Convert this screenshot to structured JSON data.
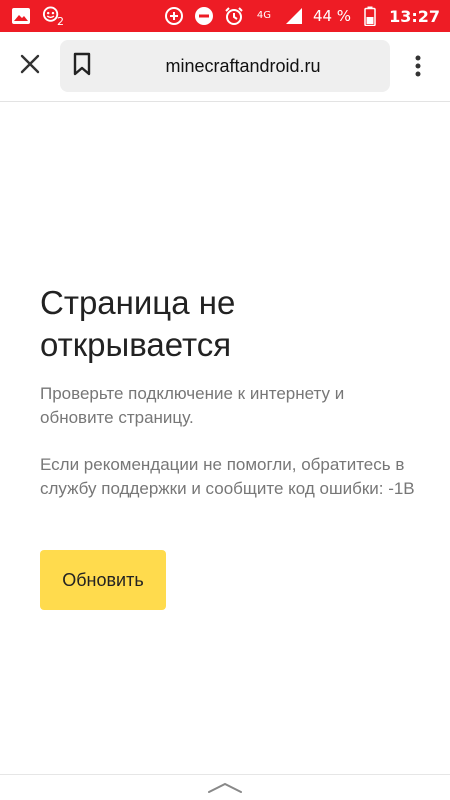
{
  "status_bar": {
    "notification_badge": "2",
    "network": "4G",
    "battery": "44 %",
    "time": "13:27",
    "color": "#ee1c25",
    "icons": [
      "image-icon",
      "app-notification-icon",
      "data-saver-icon",
      "do-not-disturb-icon",
      "alarm-icon",
      "network-4g-icon",
      "signal-icon",
      "battery-icon"
    ]
  },
  "toolbar": {
    "url": "minecraftandroid.ru",
    "close_icon": "close-icon",
    "bookmark_icon": "bookmark-icon",
    "menu_icon": "more-vertical-icon"
  },
  "error": {
    "title": "Страница не открывается",
    "paragraph1": "Проверьте подключение к интернету и обновите страницу.",
    "paragraph2": "Если рекомендации не помогли, обратитесь в службу поддержки и сообщите код ошибки: -1B",
    "reload_label": "Обновить",
    "button_color": "#ffdb4d"
  },
  "bottom": {
    "handle_icon": "chevron-up-icon"
  }
}
